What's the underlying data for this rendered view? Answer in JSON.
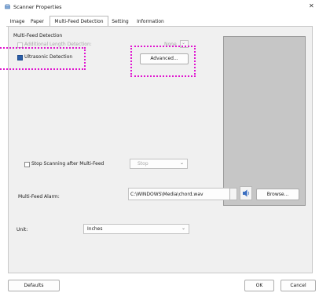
{
  "window": {
    "title": "Scanner Properties"
  },
  "tabs": [
    {
      "label": "Image"
    },
    {
      "label": "Paper"
    },
    {
      "label": "Multi-Feed Detection"
    },
    {
      "label": "Setting"
    },
    {
      "label": "Information"
    }
  ],
  "active_tab": "Multi-Feed Detection",
  "multi_feed": {
    "group_title": "Multi-Feed Detection",
    "additional_length": {
      "label": "Additional Length Detection:",
      "checked": false,
      "enabled": false,
      "value": "None"
    },
    "ultrasonic": {
      "label": "Ultrasonic Detection",
      "checked": true
    },
    "advanced_button": "Advanced...",
    "stop_scanning": {
      "label": "Stop Scanning after Multi-Feed",
      "checked": false,
      "value": "Stop"
    },
    "alarm": {
      "label": "Multi-Feed Alarm:",
      "value": "C:\\WINDOWS\\Media\\chord.wav",
      "browse_button": "Browse..."
    }
  },
  "unit": {
    "label": "Unit:",
    "value": "Inches"
  },
  "footer": {
    "defaults_button": "Defaults",
    "ok_button": "OK",
    "cancel_button": "Cancel"
  },
  "colors": {
    "highlight": "#e015d0",
    "checkbox_checked": "#2b5ea8",
    "preview_bg": "#c6c6c6"
  }
}
